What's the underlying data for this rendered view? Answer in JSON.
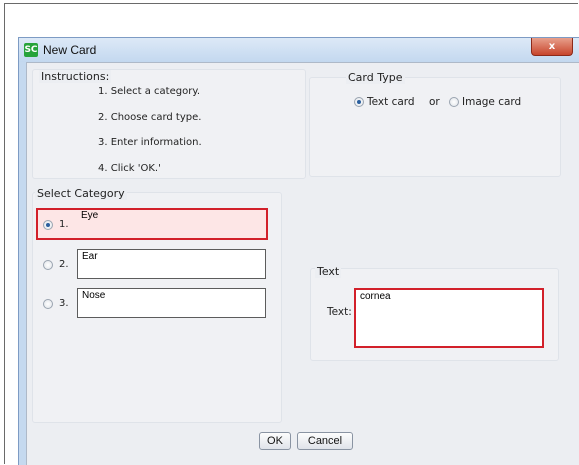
{
  "window": {
    "title": "New Card",
    "close_glyph": "x"
  },
  "instructions": {
    "legend": "Instructions:",
    "steps": [
      "1. Select a category.",
      "2. Choose card type.",
      "3. Enter information.",
      "4. Click 'OK.'"
    ]
  },
  "card_type": {
    "legend": "Card Type",
    "text_option": "Text card",
    "separator": "or",
    "image_option": "Image card",
    "selected": "Text card"
  },
  "select_category": {
    "legend": "Select Category",
    "items": [
      {
        "num": "1.",
        "value": "Eye",
        "selected": true
      },
      {
        "num": "2.",
        "value": "Ear",
        "selected": false
      },
      {
        "num": "3.",
        "value": "Nose",
        "selected": false
      }
    ]
  },
  "text_panel": {
    "legend": "Text",
    "label": "Text:",
    "value": "cornea"
  },
  "buttons": {
    "ok": "OK",
    "cancel": "Cancel"
  },
  "colors": {
    "highlight": "#d2202a",
    "accent": "#2b5f9e"
  }
}
